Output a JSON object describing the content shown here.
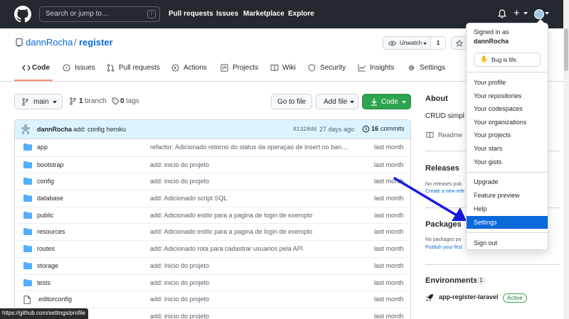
{
  "header": {
    "search_placeholder": "Search or jump to…",
    "search_key": "/",
    "nav": [
      "Pull requests",
      "Issues",
      "Marketplace",
      "Explore"
    ]
  },
  "repo": {
    "owner": "dannRocha",
    "slash": "/",
    "name": "register",
    "watch_label": "Unwatch",
    "watch_count": "1"
  },
  "tabs": [
    "Code",
    "Issues",
    "Pull requests",
    "Actions",
    "Projects",
    "Wiki",
    "Security",
    "Insights",
    "Settings"
  ],
  "toolbar": {
    "branch": "main",
    "branch_count": "1",
    "branch_label": "branch",
    "tag_count": "0",
    "tag_label": "tags",
    "goto_file": "Go to file",
    "add_file": "Add file",
    "code": "Code"
  },
  "commit": {
    "author": "dannRocha",
    "message": "add: config heroku",
    "hash": "01328d6",
    "time": "27 days ago",
    "count": "16",
    "count_label": "commits"
  },
  "files": [
    {
      "name": "app",
      "type": "dir",
      "message": "refactor: Adicionado retorno do status da operaçao de insert no ban…",
      "age": "last month"
    },
    {
      "name": "bootstrap",
      "type": "dir",
      "message": "add: inicio do projeto",
      "age": "last month"
    },
    {
      "name": "config",
      "type": "dir",
      "message": "add: inicio do projeto",
      "age": "last month"
    },
    {
      "name": "database",
      "type": "dir",
      "message": "add: Adicionado script SQL",
      "age": "last month"
    },
    {
      "name": "public",
      "type": "dir",
      "message": "add: Adicionado estilo para a pagina de login de exemplo",
      "age": "last month"
    },
    {
      "name": "resources",
      "type": "dir",
      "message": "add: Adicionado estilo para a pagina de login de exemplo",
      "age": "last month"
    },
    {
      "name": "routes",
      "type": "dir",
      "message": "add: Adicionado rota para cadastrar usuarios pela API",
      "age": "last month"
    },
    {
      "name": "storage",
      "type": "dir",
      "message": "add: inicio do projeto",
      "age": "last month"
    },
    {
      "name": "tests",
      "type": "dir",
      "message": "add: inicio do projeto",
      "age": "last month"
    },
    {
      "name": ".editorconfig",
      "type": "file",
      "message": "add: inicio do projeto",
      "age": "last month"
    },
    {
      "name": "",
      "type": "file",
      "message": "add: inicio do projeto",
      "age": "last month"
    }
  ],
  "sidebar": {
    "about_title": "About",
    "about_desc": "CRUD simpl",
    "readme": "Readme",
    "releases_title": "Releases",
    "releases_none": "No releases pub",
    "releases_create": "Create a new rele",
    "packages_title": "Packages",
    "packages_none": "No packages pu",
    "packages_publish": "Publish your first",
    "environments_title": "Environments",
    "environments_count": "1",
    "env_name": "app-register-laravel",
    "env_status": "Active"
  },
  "dropdown": {
    "signed_in_as": "Signed in as",
    "username": "dannRocha",
    "status_emoji": "✋",
    "status_text": "Bug is life.",
    "group1": [
      "Your profile",
      "Your repositories",
      "Your codespaces",
      "Your organizations",
      "Your projects",
      "Your stars",
      "Your gists"
    ],
    "group2": [
      "Upgrade",
      "Feature preview",
      "Help",
      "Settings"
    ],
    "sign_out": "Sign out",
    "active_item": "Settings"
  },
  "status_bar_url": "https://github.com/settings/profile",
  "colors": {
    "header_bg": "#24292f",
    "link": "#0969da",
    "code_button": "#2da44e",
    "dropdown_active": "#0969da",
    "arrow": "#1a1adb",
    "tab_underline": "#fd8c73"
  }
}
